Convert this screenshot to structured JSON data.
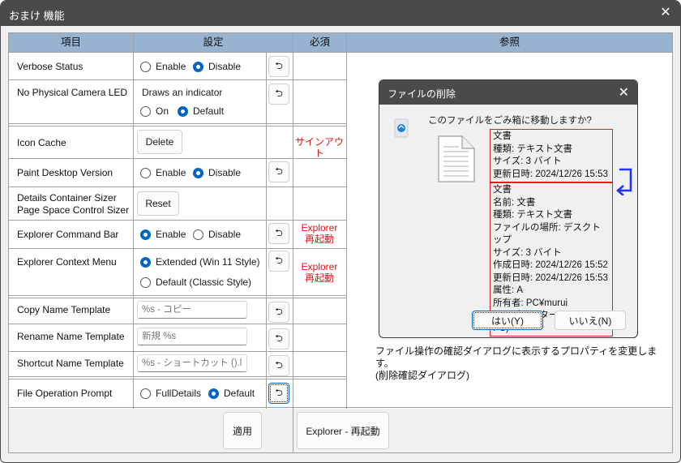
{
  "window": {
    "title": "おまけ 機能",
    "close_icon": "close-icon"
  },
  "table": {
    "headers": [
      "項目",
      "設定",
      "必須",
      "参照"
    ],
    "rows": [
      {
        "name": "Verbose Status",
        "options": [
          "Enable",
          "Disable"
        ],
        "selected": "Disable",
        "required": ""
      },
      {
        "name": "No Physical Camera LED",
        "caption": "Draws an indicator",
        "options": [
          "On",
          "Default"
        ],
        "selected": "Default",
        "required": ""
      },
      {
        "name": "Icon Cache",
        "button": "Delete",
        "required": "サインアウト"
      },
      {
        "name": "Paint Desktop Version",
        "options": [
          "Enable",
          "Disable"
        ],
        "selected": "Disable",
        "required": ""
      },
      {
        "name_lines": [
          "Details Container Sizer",
          "Page Space Control Sizer"
        ],
        "button": "Reset",
        "required": ""
      },
      {
        "name": "Explorer Command Bar",
        "options": [
          "Enable",
          "Disable"
        ],
        "selected": "Enable",
        "required_lines": [
          "Explorer",
          "再起動"
        ]
      },
      {
        "name": "Explorer Context Menu",
        "options": [
          "Extended (Win 11 Style)",
          "Default (Classic Style)"
        ],
        "selected": "Extended (Win 11 Style)",
        "required_lines": [
          "Explorer",
          "再起動"
        ]
      },
      {
        "name": "Copy Name Template",
        "placeholder": "%s - コピー",
        "value": "",
        "required": ""
      },
      {
        "name": "Rename Name Template",
        "placeholder": "新規 %s",
        "value": "",
        "required": ""
      },
      {
        "name": "Shortcut Name Template",
        "placeholder": "%s - ショートカット ().lnk",
        "value": "",
        "required": ""
      },
      {
        "name": "File Operation Prompt",
        "options": [
          "FullDetails",
          "Default"
        ],
        "selected": "Default",
        "required": ""
      }
    ]
  },
  "footer": {
    "apply_label": "適用",
    "restart_label": "Explorer - 再起動"
  },
  "reference": {
    "dialog": {
      "title": "ファイルの削除",
      "question": "このファイルをごみ箱に移動しますか?",
      "default_props": [
        "文書",
        "種類: テキスト文書",
        "サイズ: 3 バイト",
        "更新日時: 2024/12/26 15:53"
      ],
      "full_props": [
        "文書",
        "名前: 文書",
        "種類: テキスト文書",
        "ファイルの場所: デスクトップ",
        "サイズ: 3 バイト",
        "作成日時: 2024/12/26 15:52",
        "更新日時: 2024/12/26 15:53",
        "属性: A",
        "所有者: PC¥murui",
        "コンピューター: PC (この PC)"
      ],
      "yes_label": "はい(Y)",
      "no_label": "いいえ(N)"
    },
    "description_lines": [
      "ファイル操作の確認ダイアログに表示するプロパティを変更します。",
      "(削除確認ダイアログ)"
    ]
  },
  "colors": {
    "header_bg": "#97b3d0",
    "accent": "#0067c0",
    "required_text": "#e01010",
    "titlebar": "#4c4a48",
    "arrow": "#2030ff"
  }
}
